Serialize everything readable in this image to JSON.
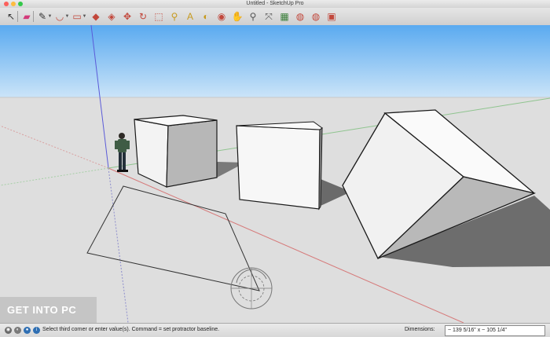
{
  "window": {
    "title": "Untitled - SketchUp Pro"
  },
  "toolbar": {
    "tools": [
      {
        "name": "select-tool-icon",
        "glyph": "↖",
        "color": "#333333"
      },
      {
        "name": "eraser-tool-icon",
        "glyph": "▰",
        "color": "#d33a7a"
      },
      {
        "name": "line-tool-icon",
        "glyph": "✎",
        "color": "#333333"
      },
      {
        "name": "arc-tool-icon",
        "glyph": "◡",
        "color": "#c2473b"
      },
      {
        "name": "rectangle-tool-icon",
        "glyph": "▭",
        "color": "#c2473b"
      },
      {
        "name": "push-pull-tool-icon",
        "glyph": "◆",
        "color": "#c2473b"
      },
      {
        "name": "follow-me-tool-icon",
        "glyph": "◈",
        "color": "#c2473b"
      },
      {
        "name": "move-tool-icon",
        "glyph": "✥",
        "color": "#c2473b"
      },
      {
        "name": "rotate-tool-icon",
        "glyph": "↻",
        "color": "#c2473b"
      },
      {
        "name": "scale-tool-icon",
        "glyph": "⬚",
        "color": "#c2473b"
      },
      {
        "name": "tape-measure-tool-icon",
        "glyph": "⚲",
        "color": "#c79a1e"
      },
      {
        "name": "text-tool-icon",
        "glyph": "A",
        "color": "#c79a1e"
      },
      {
        "name": "paint-bucket-tool-icon",
        "glyph": "◐",
        "color": "#c79a1e"
      },
      {
        "name": "orbit-tool-icon",
        "glyph": "◉",
        "color": "#c2473b"
      },
      {
        "name": "pan-tool-icon",
        "glyph": "✋",
        "color": "#555555"
      },
      {
        "name": "zoom-tool-icon",
        "glyph": "⚲",
        "color": "#555555"
      },
      {
        "name": "zoom-extents-tool-icon",
        "glyph": "⤧",
        "color": "#555555"
      },
      {
        "name": "3d-warehouse-icon",
        "glyph": "▦",
        "color": "#3a7f3a"
      },
      {
        "name": "extension-warehouse-icon",
        "glyph": "◍",
        "color": "#c2473b"
      },
      {
        "name": "share-model-icon",
        "glyph": "◍",
        "color": "#c2473b"
      },
      {
        "name": "layout-icon",
        "glyph": "▣",
        "color": "#c2473b"
      }
    ]
  },
  "status": {
    "message": "Select third corner or enter value(s). Command = set protractor baseline.",
    "dimensions_label": "Dimensions:",
    "dimensions_value": "~ 139 5/16\" x ~ 105 1/4\""
  },
  "watermark": {
    "text": "GET INTO PC"
  },
  "colors": {
    "sky_top": "#5aaaf0",
    "sky_bottom": "#cbe4f8",
    "ground": "#dedede",
    "red_axis": "#d67a7a",
    "green_axis": "#8fc48f",
    "blue_axis": "#5a5ad8"
  }
}
